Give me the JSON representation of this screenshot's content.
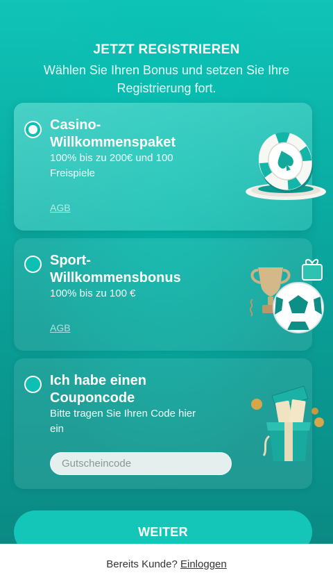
{
  "header": {
    "title": "JETZT REGISTRIEREN",
    "subtitle": "Wählen Sie Ihren Bonus und setzen Sie Ihre Registrierung fort."
  },
  "bonuses": [
    {
      "title": "Casino-Willkommenspaket",
      "description": "100% bis zu 200€ und 100 Freispiele",
      "terms_link": "AGB",
      "selected": true,
      "icon": "casino-chip-icon"
    },
    {
      "title": "Sport-Willkommensbonus",
      "description": "100% bis zu 100 €",
      "terms_link": "AGB",
      "selected": false,
      "icon": "trophy-football-icon"
    },
    {
      "title": "Ich habe einen Couponcode",
      "description": "Bitte tragen Sie Ihren Code hier ein",
      "selected": false,
      "icon": "gift-box-icon",
      "input_placeholder": "Gutscheincode",
      "input_value": ""
    }
  ],
  "continue_button": "WEITER",
  "footer": {
    "question": "Bereits Kunde?",
    "login_link": "Einloggen"
  },
  "colors": {
    "primary": "#10c3b6",
    "button": "#13c6b8",
    "background_dark": "#0a8a83"
  }
}
